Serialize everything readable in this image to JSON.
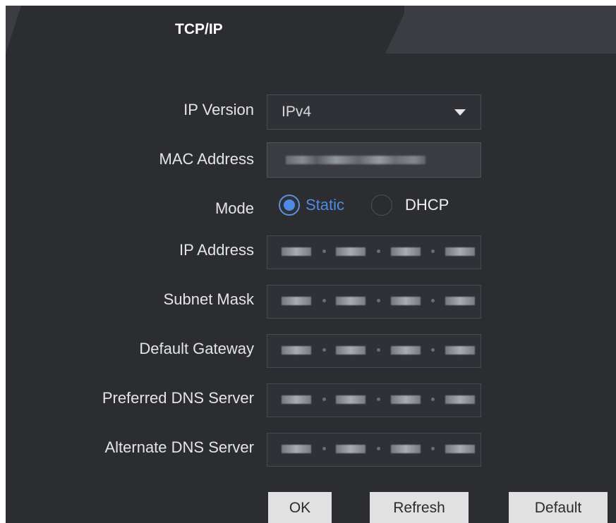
{
  "tabs": {
    "title": "TCP/IP"
  },
  "labels": {
    "ip_version": "IP Version",
    "mac_address": "MAC Address",
    "mode": "Mode",
    "ip_address": "IP Address",
    "subnet_mask": "Subnet Mask",
    "default_gateway": "Default Gateway",
    "preferred_dns_server": "Preferred DNS Server",
    "alternate_dns_server": "Alternate DNS Server"
  },
  "fields": {
    "ip_version_value": "IPv4"
  },
  "mode_options": {
    "static": "Static",
    "dhcp": "DHCP",
    "selected": "Static"
  },
  "buttons": {
    "ok": "OK",
    "refresh": "Refresh",
    "default": "Default"
  },
  "colors": {
    "panel_background": "#2b2d31",
    "inactive_tab_background": "#3b3d42",
    "accent_blue": "#4f8be4",
    "button_background": "#e1e1e1"
  },
  "icons": {
    "dropdown": "chevron-down-icon",
    "mode_static": "radio-checked-icon",
    "mode_dhcp": "radio-unchecked-icon"
  }
}
